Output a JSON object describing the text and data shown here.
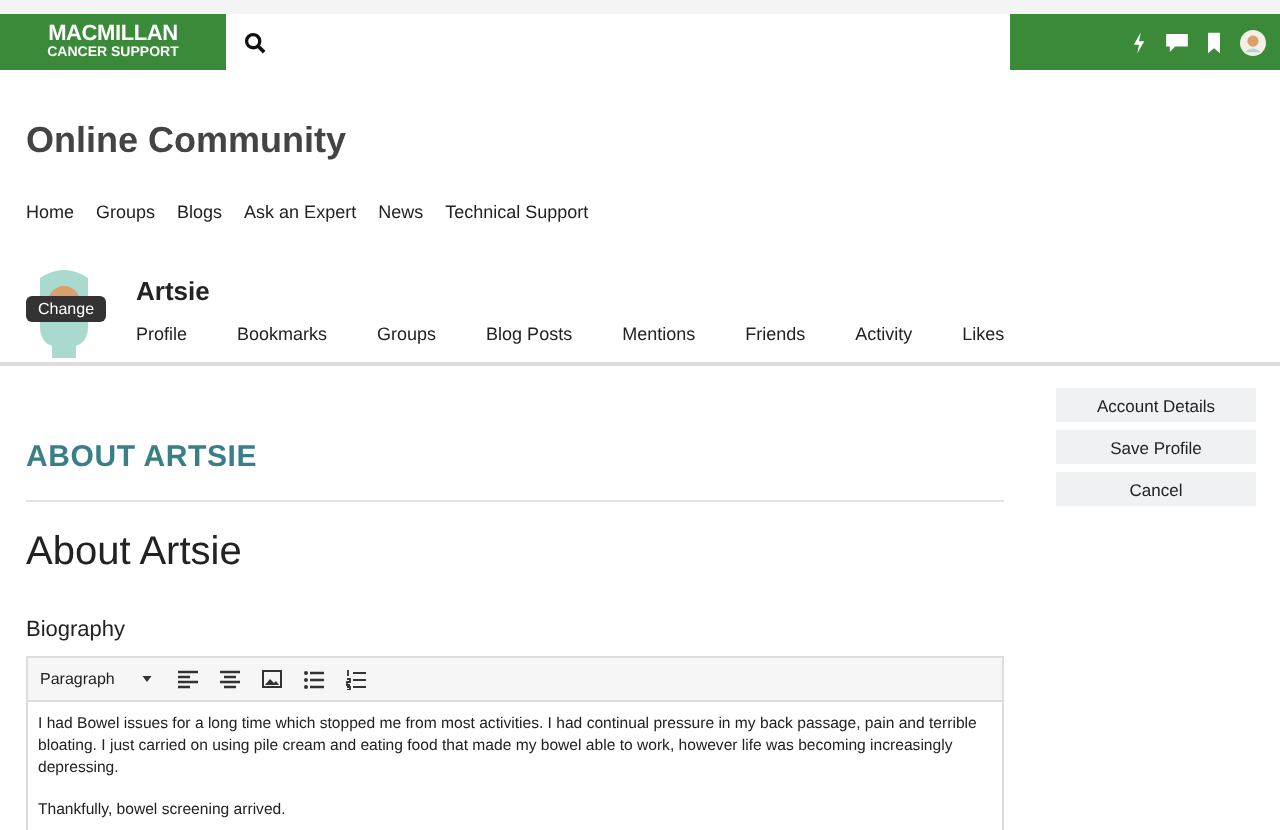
{
  "header": {
    "logo_line_1": "MACMILLAN",
    "logo_line_2": "CANCER SUPPORT"
  },
  "site_title": "Online Community",
  "nav": [
    "Home",
    "Groups",
    "Blogs",
    "Ask an Expert",
    "News",
    "Technical Support"
  ],
  "profile": {
    "name": "Artsie",
    "avatar_tooltip": "Change",
    "tabs": [
      {
        "label": "Profile",
        "selected": false
      },
      {
        "label": "Bookmarks",
        "selected": false
      },
      {
        "label": "Groups",
        "selected": false
      },
      {
        "label": "Blog Posts",
        "selected": false
      },
      {
        "label": "Mentions",
        "selected": false
      },
      {
        "label": "Friends",
        "selected": false
      },
      {
        "label": "Activity",
        "selected": false
      },
      {
        "label": "Likes",
        "selected": false
      }
    ]
  },
  "section_banner": "ABOUT ARTSIE",
  "page_heading": "About Artsie",
  "biography": {
    "label": "Biography",
    "format": "Paragraph",
    "paragraphs": [
      "I had Bowel issues for a long time which stopped me from most activities. I had continual pressure in my back passage, pain and terrible bloating.  I just carried on using pile cream and eating food that made my bowel able to work, however life was becoming increasingly depressing.",
      "Thankfully, bowel screening arrived."
    ]
  },
  "actions": [
    "Account Details",
    "Save Profile",
    "Cancel"
  ]
}
